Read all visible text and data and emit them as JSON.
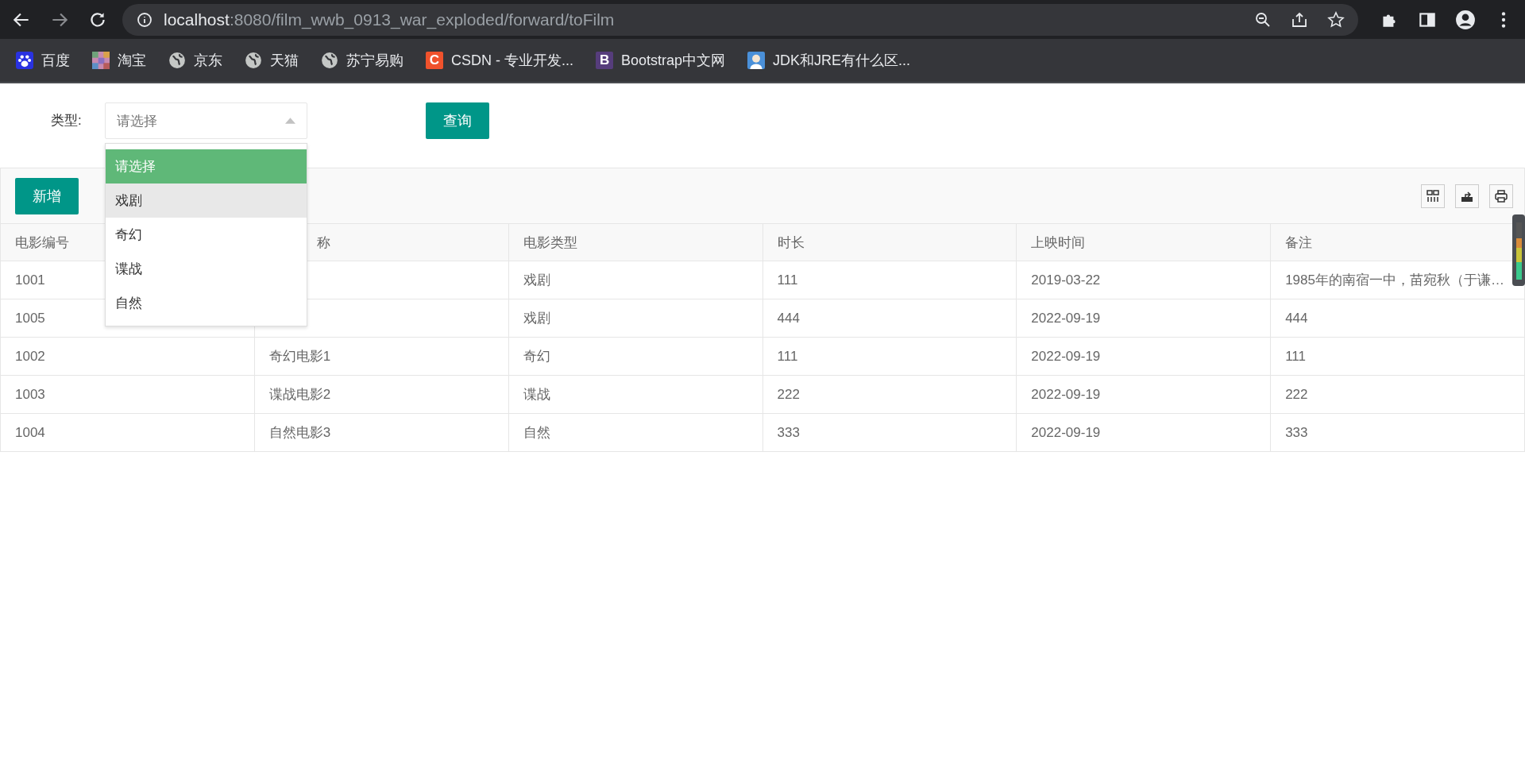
{
  "browser": {
    "url": {
      "host": "localhost",
      "path": ":8080/film_wwb_0913_war_exploded/forward/toFilm"
    },
    "bookmarks": [
      {
        "kind": "baidu",
        "label": "百度"
      },
      {
        "kind": "mosaic",
        "label": "淘宝"
      },
      {
        "kind": "globe",
        "label": "京东"
      },
      {
        "kind": "globe",
        "label": "天猫"
      },
      {
        "kind": "globe",
        "label": "苏宁易购"
      },
      {
        "kind": "letter",
        "glyph": "C",
        "color": "#f0522c",
        "label": "CSDN - 专业开发..."
      },
      {
        "kind": "letter",
        "glyph": "B",
        "color": "#563d7c",
        "label": "Bootstrap中文网"
      },
      {
        "kind": "avatar",
        "label": "JDK和JRE有什么区..."
      }
    ]
  },
  "filter": {
    "label": "类型:",
    "select": {
      "value": "请选择",
      "expanded": true
    },
    "options": [
      {
        "label": "请选择",
        "selected": true,
        "hovered": false
      },
      {
        "label": "戏剧",
        "selected": false,
        "hovered": true
      },
      {
        "label": "奇幻",
        "selected": false,
        "hovered": false
      },
      {
        "label": "谍战",
        "selected": false,
        "hovered": false
      },
      {
        "label": "自然",
        "selected": false,
        "hovered": false
      }
    ],
    "button": "查询"
  },
  "toolbar": {
    "add_button": "新增"
  },
  "table": {
    "columns": [
      "电影编号",
      "称",
      "电影类型",
      "时长",
      "上映时间",
      "备注"
    ],
    "rows": [
      {
        "id": "1001",
        "type": "戏剧",
        "duration": "111",
        "date": "2019-03-22",
        "note": "1985年的南宿一中，苗宛秋（于谦…"
      },
      {
        "id": "1005",
        "type": "戏剧",
        "duration": "444",
        "date": "2022-09-19",
        "note": "444"
      },
      {
        "id": "1002",
        "name": "奇幻电影1",
        "type": "奇幻",
        "duration": "111",
        "date": "2022-09-19",
        "note": "111"
      },
      {
        "id": "1003",
        "name": "谍战电影2",
        "type": "谍战",
        "duration": "222",
        "date": "2022-09-19",
        "note": "222"
      },
      {
        "id": "1004",
        "name": "自然电影3",
        "type": "自然",
        "duration": "333",
        "date": "2022-09-19",
        "note": "333"
      }
    ]
  }
}
